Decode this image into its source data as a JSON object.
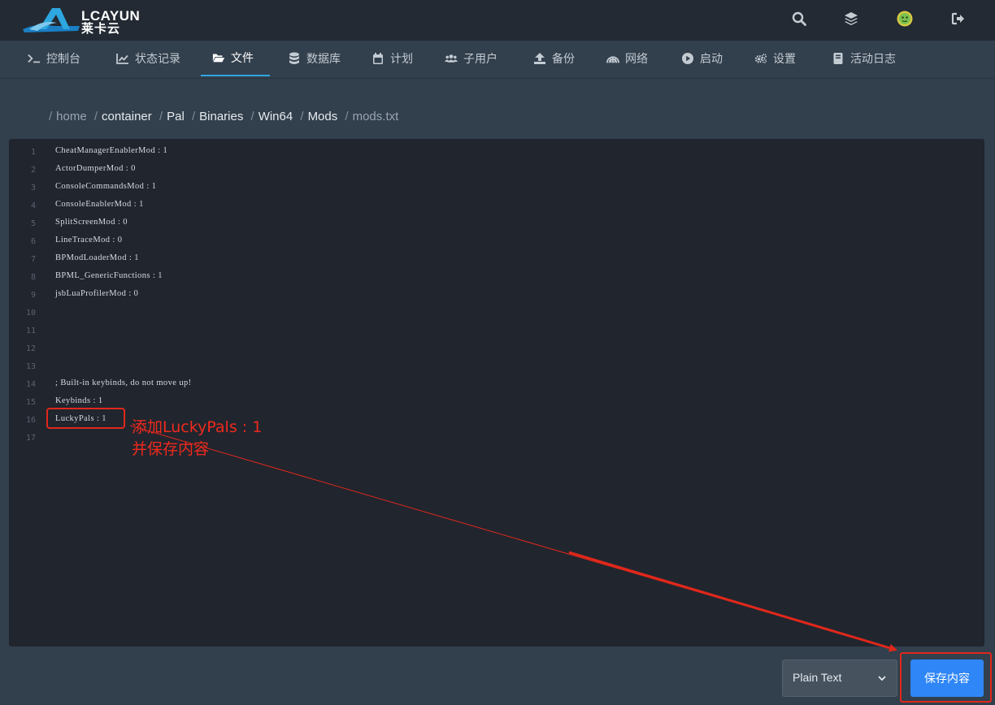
{
  "brand": {
    "name_en": "LCAYUN",
    "name_cn": "莱卡云"
  },
  "header_icons": [
    "search-icon",
    "layers-icon",
    "avatar",
    "logout-icon"
  ],
  "nav": {
    "tabs": [
      {
        "label": "控制台",
        "icon": "terminal-icon"
      },
      {
        "label": "状态记录",
        "icon": "chart-line-icon"
      },
      {
        "label": "文件",
        "icon": "folder-open-icon",
        "active": true
      },
      {
        "label": "数据库",
        "icon": "database-icon"
      },
      {
        "label": "计划",
        "icon": "calendar-icon"
      },
      {
        "label": "子用户",
        "icon": "users-icon"
      },
      {
        "label": "备份",
        "icon": "upload-icon"
      },
      {
        "label": "网络",
        "icon": "network-icon"
      },
      {
        "label": "启动",
        "icon": "play-circle-icon"
      },
      {
        "label": "设置",
        "icon": "cogs-icon"
      },
      {
        "label": "活动日志",
        "icon": "book-icon"
      }
    ]
  },
  "breadcrumb": {
    "root": "home",
    "segments": [
      "container",
      "Pal",
      "Binaries",
      "Win64",
      "Mods"
    ],
    "current": "mods.txt"
  },
  "editor": {
    "lines": [
      "CheatManagerEnablerMod : 1",
      "ActorDumperMod : 0",
      "ConsoleCommandsMod : 1",
      "ConsoleEnablerMod : 1",
      "SplitScreenMod : 0",
      "LineTraceMod : 0",
      "BPModLoaderMod : 1",
      "BPML_GenericFunctions : 1",
      "jsbLuaProfilerMod : 0",
      "",
      "",
      "",
      "",
      "; Built-in keybinds, do not move up!",
      "Keybinds : 1",
      "LuckyPals : 1",
      ""
    ]
  },
  "annotation": {
    "line1": "添加LuckyPals : 1",
    "line2": "并保存内容",
    "color": "#e0281b"
  },
  "footer": {
    "language_select": "Plain Text",
    "save_button": "保存内容"
  },
  "colors": {
    "accent": "#2ea7e0",
    "save_button": "#2f86f6",
    "editor_bg": "#21252e"
  }
}
